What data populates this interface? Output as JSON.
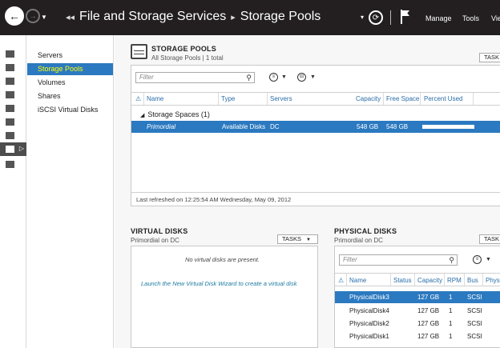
{
  "header": {
    "breadcrumb": [
      "File and Storage Services",
      "Storage Pools"
    ],
    "menu": [
      "Manage",
      "Tools",
      "Vie"
    ]
  },
  "nav_list": [
    "Servers",
    "Storage Pools",
    "Volumes",
    "Shares",
    "iSCSI Virtual Disks"
  ],
  "storage_pools": {
    "title": "STORAGE POOLS",
    "subtitle": "All Storage Pools | 1 total",
    "tasks": "TASK",
    "filter_placeholder": "Filter",
    "columns": [
      "Name",
      "Type",
      "Servers",
      "Capacity",
      "Free Space",
      "Percent Used"
    ],
    "group": "Storage Spaces (1)",
    "rows": [
      {
        "name": "Primordial",
        "type": "Available Disks",
        "server": "DC",
        "capacity": "548 GB",
        "free": "548 GB",
        "percent_used": 0
      }
    ],
    "last_refreshed": "Last refreshed on 12:25:54 AM Wednesday, May 09, 2012"
  },
  "virtual_disks": {
    "title": "VIRTUAL DISKS",
    "subtitle": "Primordial on DC",
    "tasks": "TASKS",
    "empty_message": "No virtual disks are present.",
    "wizard_link": "Launch the New Virtual Disk Wizard to create a virtual disk"
  },
  "physical_disks": {
    "title": "PHYSICAL DISKS",
    "subtitle": "Primordial on DC",
    "tasks": "TASK",
    "filter_placeholder": "Filter",
    "columns": [
      "Name",
      "Status",
      "Capacity",
      "RPM",
      "Bus",
      "Physi"
    ],
    "rows": [
      {
        "name": "PhysicalDisk3",
        "status": "",
        "capacity": "127 GB",
        "rpm": "1",
        "bus": "SCSI"
      },
      {
        "name": "PhysicalDisk4",
        "status": "",
        "capacity": "127 GB",
        "rpm": "1",
        "bus": "SCSI"
      },
      {
        "name": "PhysicalDisk2",
        "status": "",
        "capacity": "127 GB",
        "rpm": "1",
        "bus": "SCSI"
      },
      {
        "name": "PhysicalDisk1",
        "status": "",
        "capacity": "127 GB",
        "rpm": "1",
        "bus": "SCSI"
      }
    ]
  },
  "colors": {
    "header_bg": "#231f20",
    "selection": "#2b79c0",
    "selected_nav_text": "#ffff00",
    "link": "#1c7aa0"
  }
}
